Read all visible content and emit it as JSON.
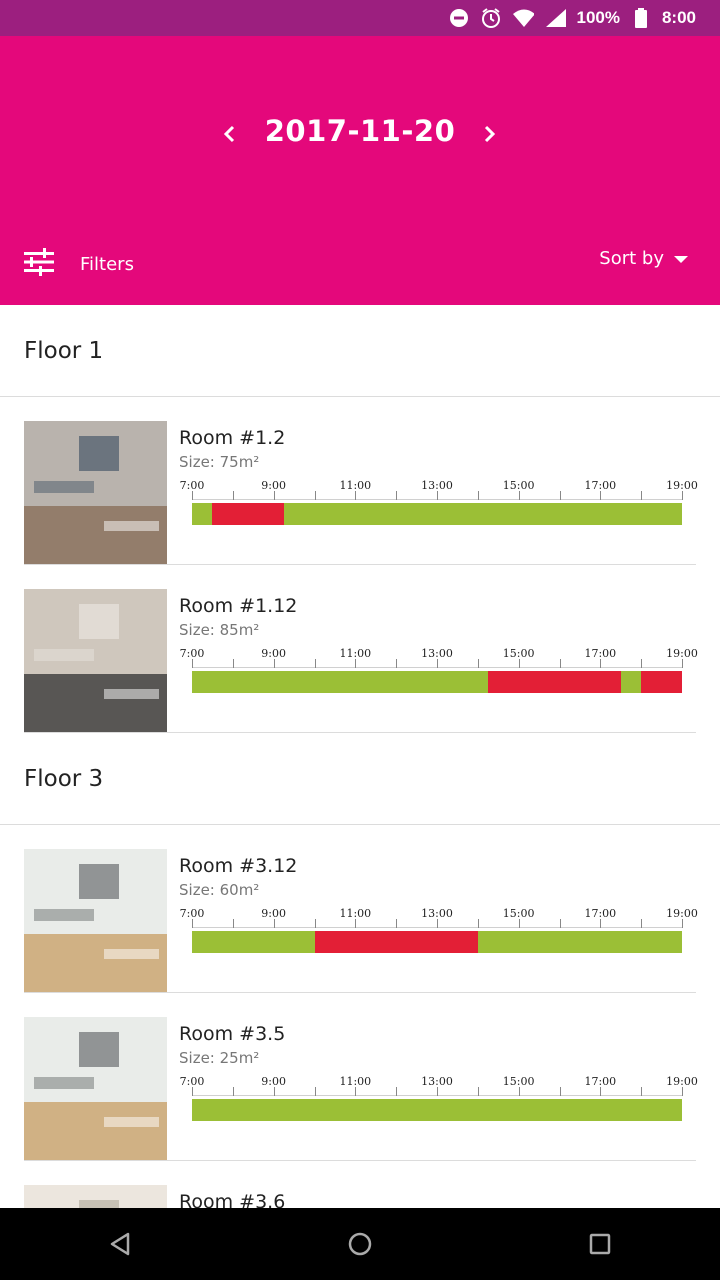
{
  "status_bar": {
    "battery": "100%",
    "time": "8:00",
    "network": "LTE",
    "icons": [
      "do-not-disturb-icon",
      "alarm-icon",
      "wifi-icon",
      "signal-icon",
      "battery-icon"
    ]
  },
  "header": {
    "date": "2017-11-20",
    "filters_label": "Filters",
    "sort_label": "Sort by",
    "background": "#e4087b"
  },
  "timeline_ticks": [
    "7:00",
    "9:00",
    "11:00",
    "13:00",
    "15:00",
    "17:00",
    "19:00"
  ],
  "colors": {
    "free": "#9bbf36",
    "booked": "#e31f36"
  },
  "floors": [
    {
      "title": "Floor 1",
      "rooms": [
        {
          "name": "Room #1.2",
          "size": "Size: 75m²",
          "image": "conference-room-photo",
          "booked": [
            [
              7.5,
              9.25
            ]
          ]
        },
        {
          "name": "Room #1.12",
          "size": "Size: 85m²",
          "image": "classroom-chairs-photo",
          "booked": [
            [
              14.25,
              17.5
            ],
            [
              18.0,
              19.0
            ]
          ]
        }
      ]
    },
    {
      "title": "Floor 3",
      "rooms": [
        {
          "name": "Room #3.12",
          "size": "Size: 60m²",
          "image": "classroom-photo",
          "booked": [
            [
              10.0,
              14.0
            ]
          ]
        },
        {
          "name": "Room #3.5",
          "size": "Size: 25m²",
          "image": "classroom-photo",
          "booked": []
        },
        {
          "name": "Room #3.6",
          "size": "",
          "image": "room-photo",
          "booked": []
        }
      ]
    }
  ]
}
